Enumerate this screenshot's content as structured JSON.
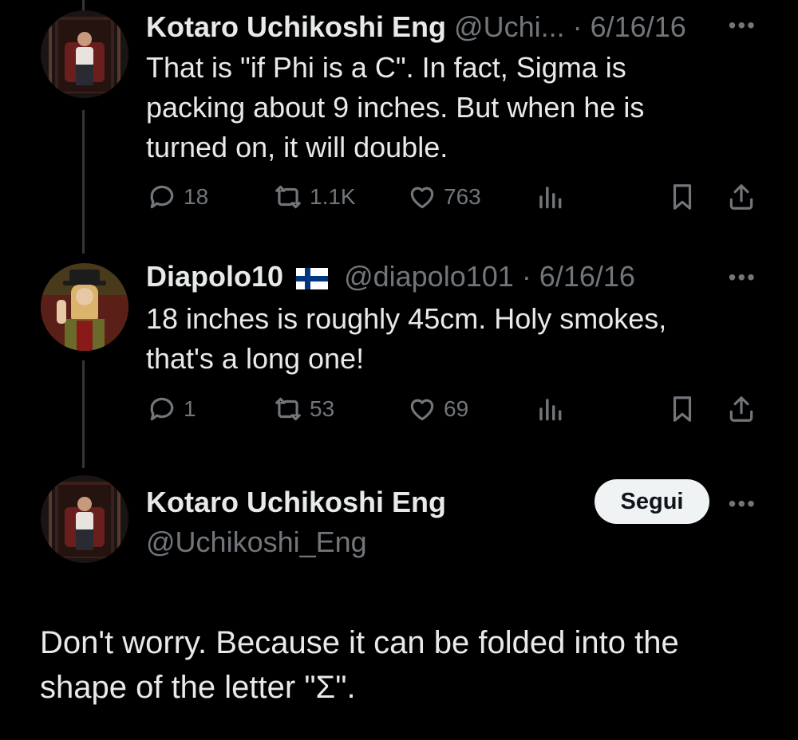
{
  "tweets": [
    {
      "author": "Kotaro Uchikoshi Eng",
      "handle": "@Uchi...",
      "date": "· 6/16/16",
      "text": "That is \"if Phi is a C\". In fact, Sigma is packing about 9 inches. But when he is turned on, it will double.",
      "replies": "18",
      "retweets": "1.1K",
      "likes": "763"
    },
    {
      "author": "Diapolo10",
      "flag": "finland-flag",
      "handle": "@diapolo101",
      "date": "· 6/16/16",
      "text": "18 inches is roughly 45cm. Holy smokes, that's a long one!",
      "replies": "1",
      "retweets": "53",
      "likes": "69"
    }
  ],
  "main_tweet": {
    "author": "Kotaro Uchikoshi Eng",
    "handle": "@Uchikoshi_Eng",
    "follow_label": "Segui",
    "text": "Don't worry. Because it can be folded into the shape of the letter \"Σ\"."
  },
  "more_label": "•••",
  "icons": [
    "reply-icon",
    "retweet-icon",
    "like-icon",
    "views-icon",
    "bookmark-icon",
    "share-icon",
    "more-icon"
  ],
  "colors": {
    "background": "#000000",
    "text": "#e7e9ea",
    "muted": "#71767b",
    "button": "#eff3f4",
    "flag_blue": "#003580"
  }
}
